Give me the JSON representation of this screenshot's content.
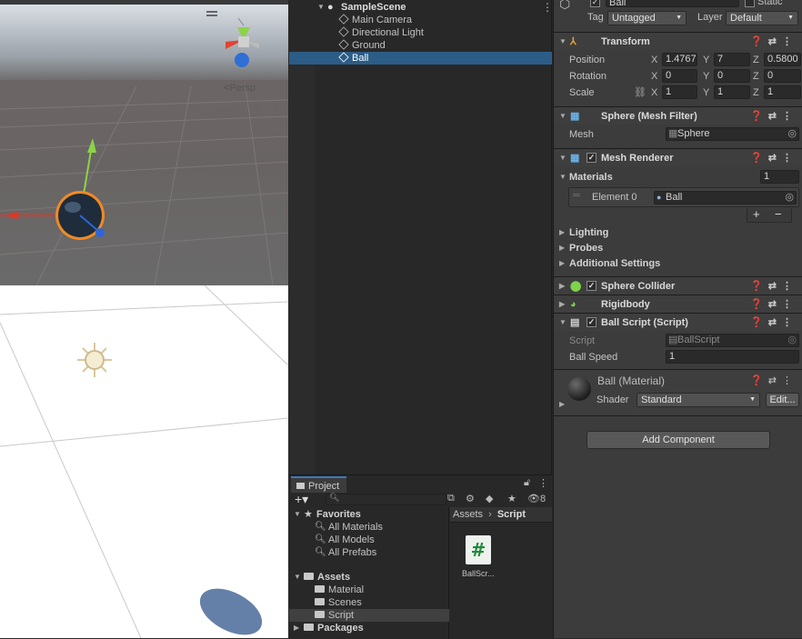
{
  "scene": {
    "persp_label": "<Persp"
  },
  "hierarchy": {
    "scene_name": "SampleScene",
    "items": [
      "Main Camera",
      "Directional Light",
      "Ground",
      "Ball"
    ],
    "selected": "Ball"
  },
  "project": {
    "tab": "Project",
    "hidden_count": "8",
    "favorites_label": "Favorites",
    "favorites": [
      "All Materials",
      "All Models",
      "All Prefabs"
    ],
    "assets_label": "Assets",
    "assets": [
      "Material",
      "Scenes",
      "Script"
    ],
    "packages_label": "Packages",
    "breadcrumb": [
      "Assets",
      "Script"
    ],
    "file_name": "BallScr...",
    "file_icon_glyph": "#"
  },
  "inspector": {
    "object_name": "Ball",
    "static_label": "Static",
    "tag_label": "Tag",
    "tag_value": "Untagged",
    "layer_label": "Layer",
    "layer_value": "Default",
    "transform": {
      "title": "Transform",
      "position_label": "Position",
      "rotation_label": "Rotation",
      "scale_label": "Scale",
      "position": [
        "1.4767",
        "7",
        "0.5800"
      ],
      "rotation": [
        "0",
        "0",
        "0"
      ],
      "scale": [
        "1",
        "1",
        "1"
      ],
      "axes": [
        "X",
        "Y",
        "Z"
      ]
    },
    "mesh_filter": {
      "title": "Sphere (Mesh Filter)",
      "mesh_label": "Mesh",
      "mesh_value": "Sphere"
    },
    "mesh_renderer": {
      "title": "Mesh Renderer",
      "materials_label": "Materials",
      "materials_count": "1",
      "element_label": "Element 0",
      "element_value": "Ball",
      "plus": "+",
      "minus": "−",
      "lighting": "Lighting",
      "probes": "Probes",
      "additional": "Additional Settings"
    },
    "sphere_collider": {
      "title": "Sphere Collider"
    },
    "rigidbody": {
      "title": "Rigidbody"
    },
    "ball_script": {
      "title": "Ball Script (Script)",
      "script_label": "Script",
      "script_value": "BallScript",
      "speed_label": "Ball Speed",
      "speed_value": "1"
    },
    "material": {
      "title": "Ball (Material)",
      "shader_label": "Shader",
      "shader_value": "Standard",
      "edit_label": "Edit..."
    },
    "add_component": "Add Component"
  }
}
